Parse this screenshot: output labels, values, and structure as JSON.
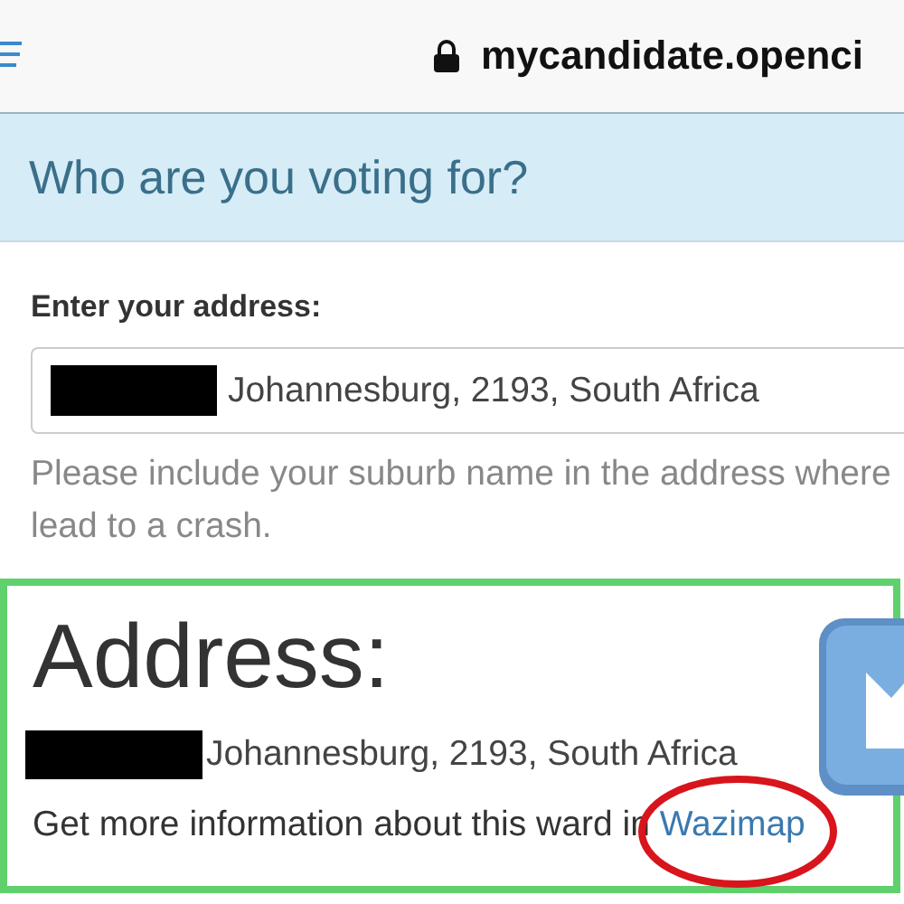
{
  "browser_bar": {
    "url": "mycandidate.openci"
  },
  "banner": {
    "title": "Who are you voting for?"
  },
  "address_form": {
    "label": "Enter your address:",
    "value": "Johannesburg, 2193, South Africa",
    "hint_lines": [
      "Please include your suburb name in the address where",
      "lead to a crash."
    ]
  },
  "result": {
    "heading": "Address:",
    "address": "Johannesburg, 2193, South Africa",
    "info_text": "Get more information about this ward in",
    "link": "Wazimap"
  }
}
